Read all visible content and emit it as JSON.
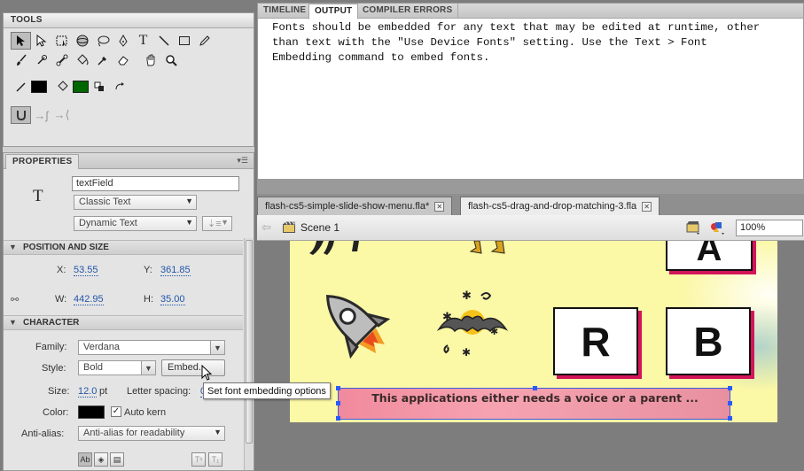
{
  "tools_panel": {
    "title": "TOOLS",
    "tools": [
      {
        "name": "selection-tool",
        "glyph": "↖"
      },
      {
        "name": "subselection-tool",
        "glyph": "⬉"
      },
      {
        "name": "free-transform-tool",
        "glyph": "⛶"
      },
      {
        "name": "3d-rotation-tool",
        "glyph": "◐"
      },
      {
        "name": "lasso-tool",
        "glyph": "ⵔ"
      },
      {
        "name": "pen-tool",
        "glyph": "✒"
      },
      {
        "name": "text-tool",
        "glyph": "T"
      },
      {
        "name": "line-tool",
        "glyph": "╲"
      },
      {
        "name": "rectangle-tool",
        "glyph": "□"
      },
      {
        "name": "pencil-tool",
        "glyph": "✎"
      },
      {
        "name": "brush-tool",
        "glyph": "⌇"
      },
      {
        "name": "deco-tool",
        "glyph": "❉"
      },
      {
        "name": "bone-tool",
        "glyph": "⟡"
      },
      {
        "name": "paint-bucket-tool",
        "glyph": "⛁"
      },
      {
        "name": "eyedropper-tool",
        "glyph": "⚲"
      },
      {
        "name": "eraser-tool",
        "glyph": "▱"
      },
      {
        "name": "hand-tool",
        "glyph": "✋"
      },
      {
        "name": "zoom-tool",
        "glyph": "⚲"
      }
    ],
    "stroke_color": "#000000",
    "fill_color": "#006600"
  },
  "properties_panel": {
    "tab": "PROPERTIES",
    "instance_name": "textField",
    "text_engine": "Classic Text",
    "text_type": "Dynamic Text",
    "sections": {
      "position": "POSITION AND SIZE",
      "character": "CHARACTER"
    },
    "position": {
      "x_label": "X:",
      "x": "53.55",
      "y_label": "Y:",
      "y": "361.85",
      "w_label": "W:",
      "w": "442.95",
      "h_label": "H:",
      "h": "35.00"
    },
    "character": {
      "family_label": "Family:",
      "family": "Verdana",
      "style_label": "Style:",
      "style": "Bold",
      "embed_button": "Embed...",
      "size_label": "Size:",
      "size": "12.0",
      "size_unit": "pt",
      "letter_spacing_label": "Letter spacing:",
      "letter_spacing": "0",
      "color_label": "Color:",
      "color": "#000000",
      "auto_kern_label": "Auto kern",
      "auto_kern_checked": true,
      "anti_alias_label": "Anti-alias:",
      "anti_alias": "Anti-alias for readability"
    },
    "tooltip": "Set font embedding options"
  },
  "output_panel": {
    "tabs": [
      "TIMELINE",
      "OUTPUT",
      "COMPILER ERRORS"
    ],
    "active_tab": "OUTPUT",
    "text": "Fonts should be embedded for any text that may be edited at runtime, other\nthan text with the \"Use Device Fonts\" setting. Use the Text > Font\nEmbedding command to embed fonts."
  },
  "document_tabs": [
    {
      "label": "flash-cs5-simple-slide-show-menu.fla*",
      "active": false
    },
    {
      "label": "flash-cs5-drag-and-drop-matching-3.fla",
      "active": true
    }
  ],
  "edit_bar": {
    "scene": "Scene 1",
    "zoom": "100%"
  },
  "stage": {
    "cards": [
      "A",
      "R",
      "B"
    ],
    "text_field": "This applications either needs a voice or a parent ...",
    "background_color": "#fbf8a6",
    "card_shadow_color": "#d4145a"
  }
}
